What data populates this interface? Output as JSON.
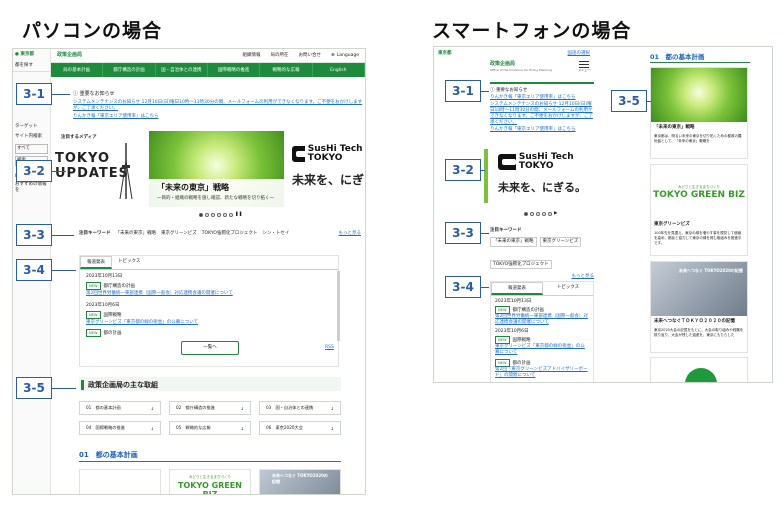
{
  "headings": {
    "pc": "パソコンの場合",
    "sp": "スマートフォンの場合"
  },
  "callouts": {
    "c31": "3-1",
    "c32": "3-2",
    "c33": "3-3",
    "c34": "3-4",
    "c35": "3-5"
  },
  "pc": {
    "sidebar": {
      "items": [
        "都を探す",
        "ターゲット",
        "サイト内検索",
        "すべて",
        "検索",
        "My TOKYO",
        "おすすめの情報を"
      ]
    },
    "header": {
      "logo": "東京都",
      "dept": "政策企画局",
      "links": [
        "組織情報",
        "局の所在",
        "お問い合せ",
        "Language"
      ]
    },
    "nav": [
      "局の基本計画",
      "都庁構造の計画",
      "国・自治体との連携",
      "国際戦略の推進",
      "戦略的な広報",
      "English"
    ],
    "notices": {
      "title": "重要なお知らせ",
      "items": [
        "システムメンテナンスのお知らせ 12月10日(日)曜日10時～11時30分の間、メールフォームの利用ができなくなります。ご不便をおかけしますが、ご了承ください。",
        "りんかき報「東京エリア使用率」はこちら"
      ]
    },
    "hero": {
      "left_top": "注目するメディア",
      "left_text": "TOKYO UPDATES",
      "center_title": "「未来の東京」戦略",
      "center_sub": "一目的・組織の戦略を施し確認、新たな戦略を切り拓く一",
      "right_logo": "SusHi Tech TOKYO",
      "right_text": "未来を、にぎ"
    },
    "keywords": {
      "label": "注目キーワード",
      "items": [
        "「未来の東京」戦略",
        "東京グリーンビズ",
        "TOKYO強靭化プロジェクト",
        "シン・トセイ"
      ],
      "more": "もっと見る"
    },
    "news": {
      "tabs": [
        "報道発表",
        "トピックス"
      ],
      "items": [
        {
          "date": "2023年10月13日",
          "badge": "NEW",
          "cat": "都庁構造の計画",
          "text": "第2回世界労働統一東部連携（国際一般会）対応連携会議の開催について"
        },
        {
          "date": "2023年10月6日",
          "badge": "NEW",
          "cat": "国際戦略",
          "text": "東京グリーンビズ「東京都の緑の街並」の公募について"
        },
        {
          "date": "",
          "badge": "NEW",
          "cat": "都の計画",
          "text": ""
        }
      ],
      "list_btn": "一覧へ",
      "rss": "RSS"
    },
    "initiatives": {
      "title": "政策企画局の主な取組",
      "items": [
        "01　都の基本計画",
        "02　都庁構造の推進",
        "03　国・自治体との連携",
        "04　国際戦略の推進",
        "05　戦略的な広報",
        "06　東京2020大会"
      ]
    },
    "section01": {
      "title": "01　都の基本計画",
      "green_biz": "TOKYO GREEN BIZ",
      "green_biz_sub": "みどりと生きるまちづくり",
      "photo_text": "未来へつなぐ TOKYO2020の記憶"
    }
  },
  "sp": {
    "header": {
      "logo": "東京都",
      "dept": "政策企画局",
      "sub": "Office of the Governor for Policy Planning",
      "links": [
        "国語の選択",
        "メニュー"
      ]
    },
    "notices": {
      "title": "重要なお知らせ",
      "items": [
        "りんかき報「東京エリア使用率」はこちら",
        "システムメンテナンスのお知らせ 12月10日(日)曜日10時～11時30分の間、メールフォームの利用ができなくなります。ご不便をおかけしますが、ご了承ください。",
        "りんかき報「東京エリア使用率」はこちら"
      ]
    },
    "hero": {
      "logo": "SusHi Tech TOKYO",
      "text": "未来を、にぎる。"
    },
    "keywords": {
      "label": "注目キーワード",
      "items": [
        "「未来の東京」戦略",
        "東京グリーンビズ",
        "TOKYO強靭化プロジェクト"
      ],
      "more": "もっと見る"
    },
    "news": {
      "tabs": [
        "報道発表",
        "トピックス"
      ],
      "items": [
        {
          "date": "2023年10月13日",
          "badge": "NEW",
          "cat": "都庁構造の計画",
          "text": "第2回世界労働統一東部連携（国際一般会）対応連携会議の開催について"
        },
        {
          "date": "2023年10月6日",
          "badge": "NEW",
          "cat": "国際戦略",
          "text": "東京グリーンビズ「東京都の緑の街並」の公募について"
        },
        {
          "date": "",
          "badge": "NEW",
          "cat": "都の計画",
          "text": "第2回「東京グリーンビズアドバイザリーボード」の開催について"
        }
      ]
    },
    "right": {
      "section_title": "01　都の基本計画",
      "cards": [
        {
          "title": "「未来の東京」戦略",
          "text": "東京都は、明るい未来の東京を切り拓くための都政の羅針盤として、「未来の東京」戦略を"
        },
        {
          "title": "東京グリーンビズ",
          "text": "100年先を見据え、東京の緑を増やす事を視覚して価値を高め、都民と協力して東京の緑を育む取組みを推進中です。",
          "logo": "TOKYO GREEN BIZ",
          "logo_sub": "みどりと生きるまちづくり"
        },
        {
          "title": "未来へつなぐＴＯＫＹＯ２０２０の記憶",
          "text": "東京2020大会の記憶をもとに、大会の取り組みや経験を振り返り、大会が残した遺産を、東京にもたらした",
          "photo_text": "未来へつなぐ TOKYO2020の記憶"
        }
      ]
    }
  },
  "colors": {
    "brand": "#1e8a3c",
    "callout": "#2a5da8",
    "link": "#1a6fd1"
  }
}
